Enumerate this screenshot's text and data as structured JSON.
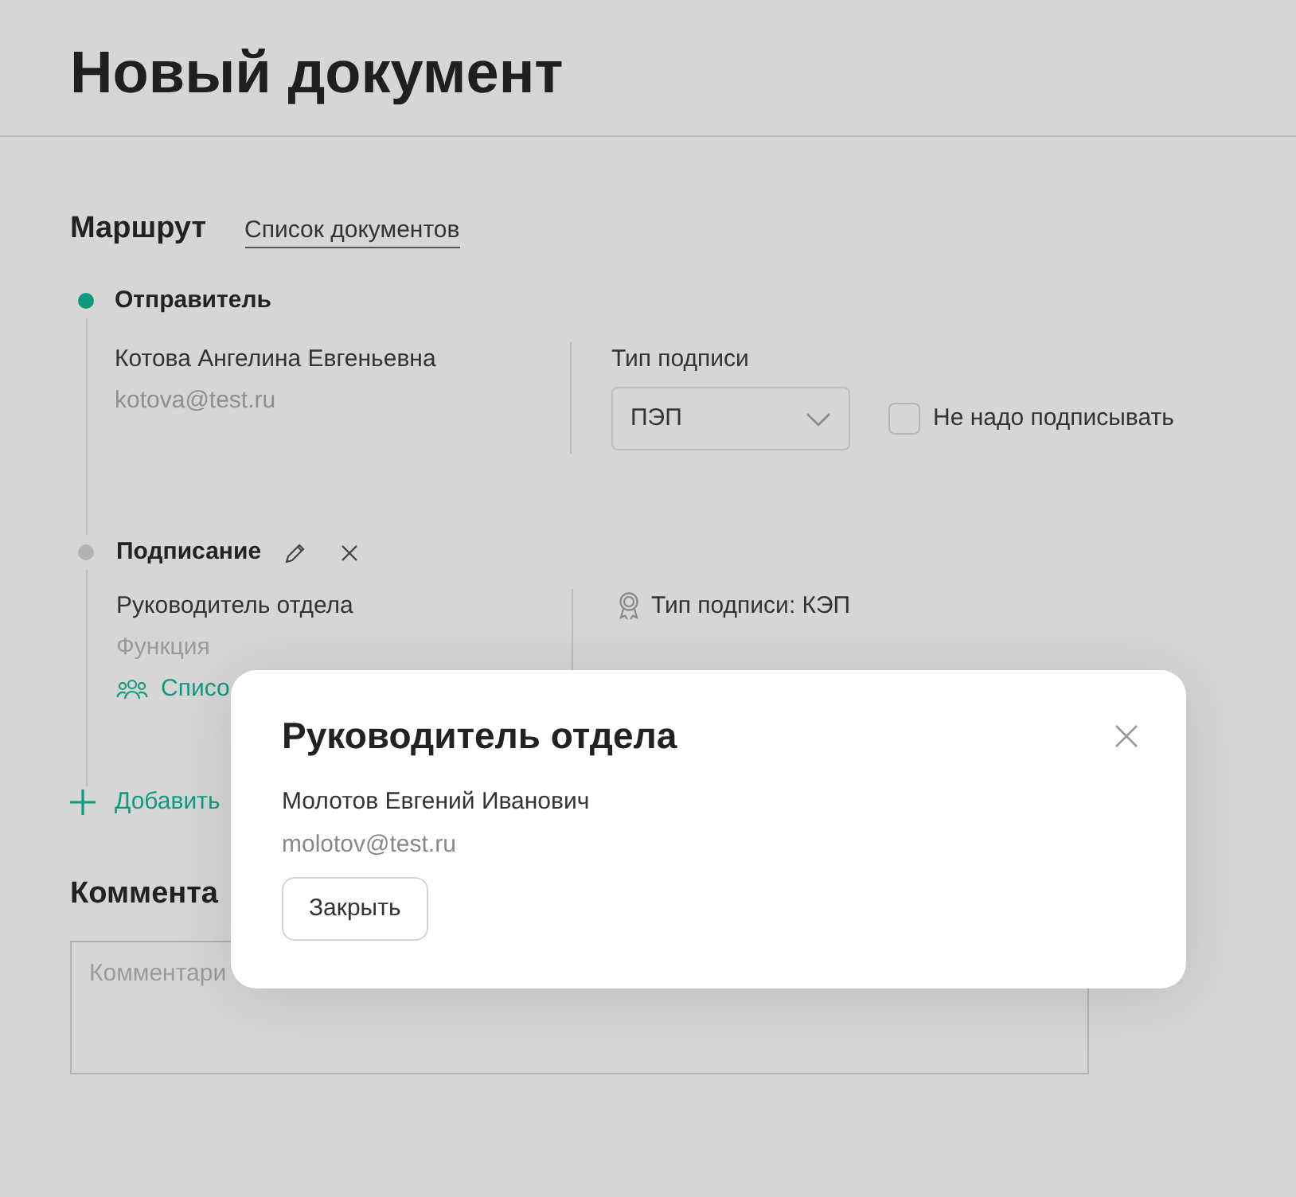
{
  "page_title": "Новый документ",
  "route": {
    "title": "Маршрут",
    "link": "Список документов"
  },
  "steps": [
    {
      "kind": "sender",
      "title": "Отправитель",
      "active": true,
      "name": "Котова Ангелина Евгеньевна",
      "email": "kotova@test.ru",
      "signature_label": "Тип подписи",
      "signature_value": "ПЭП",
      "no_sign": {
        "label": "Не надо подписывать",
        "checked": false
      }
    },
    {
      "kind": "signing",
      "title": "Подписание",
      "active": false,
      "role": "Руководитель отдела",
      "function": "Функция",
      "list_link": "Списо",
      "signature_text": "Тип подписи: КЭП"
    }
  ],
  "add_link": "Добавить",
  "comment": {
    "title": "Коммента",
    "placeholder": "Комментари"
  },
  "modal": {
    "title": "Руководитель отдела",
    "name": "Молотов Евгений Иванович",
    "email": "molotov@test.ru",
    "button": "Закрыть"
  }
}
